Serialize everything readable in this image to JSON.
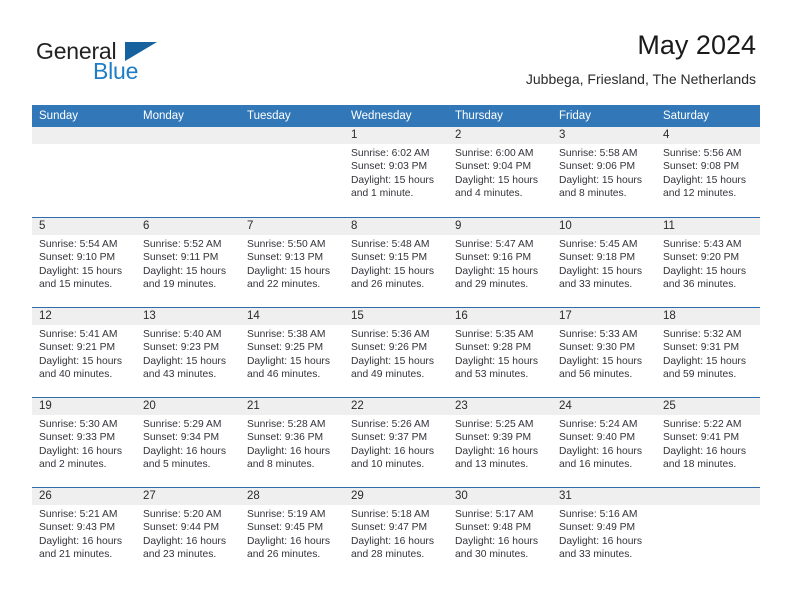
{
  "brand": {
    "word_general": "General",
    "word_blue": "Blue",
    "flag_icon": "blue-triangle-flag"
  },
  "header": {
    "title": "May 2024",
    "subtitle": "Jubbega, Friesland, The Netherlands"
  },
  "colors": {
    "header_blue": "#3278b9",
    "separator_blue": "#2f6ca8",
    "daynum_band": "#efefef",
    "brand_blue": "#1f7dc4",
    "text": "#33333a"
  },
  "weekdays": [
    "Sunday",
    "Monday",
    "Tuesday",
    "Wednesday",
    "Thursday",
    "Friday",
    "Saturday"
  ],
  "weeks": [
    [
      {
        "day": "",
        "lines": []
      },
      {
        "day": "",
        "lines": []
      },
      {
        "day": "",
        "lines": []
      },
      {
        "day": "1",
        "lines": [
          "Sunrise: 6:02 AM",
          "Sunset: 9:03 PM",
          "Daylight: 15 hours",
          "and 1 minute."
        ]
      },
      {
        "day": "2",
        "lines": [
          "Sunrise: 6:00 AM",
          "Sunset: 9:04 PM",
          "Daylight: 15 hours",
          "and 4 minutes."
        ]
      },
      {
        "day": "3",
        "lines": [
          "Sunrise: 5:58 AM",
          "Sunset: 9:06 PM",
          "Daylight: 15 hours",
          "and 8 minutes."
        ]
      },
      {
        "day": "4",
        "lines": [
          "Sunrise: 5:56 AM",
          "Sunset: 9:08 PM",
          "Daylight: 15 hours",
          "and 12 minutes."
        ]
      }
    ],
    [
      {
        "day": "5",
        "lines": [
          "Sunrise: 5:54 AM",
          "Sunset: 9:10 PM",
          "Daylight: 15 hours",
          "and 15 minutes."
        ]
      },
      {
        "day": "6",
        "lines": [
          "Sunrise: 5:52 AM",
          "Sunset: 9:11 PM",
          "Daylight: 15 hours",
          "and 19 minutes."
        ]
      },
      {
        "day": "7",
        "lines": [
          "Sunrise: 5:50 AM",
          "Sunset: 9:13 PM",
          "Daylight: 15 hours",
          "and 22 minutes."
        ]
      },
      {
        "day": "8",
        "lines": [
          "Sunrise: 5:48 AM",
          "Sunset: 9:15 PM",
          "Daylight: 15 hours",
          "and 26 minutes."
        ]
      },
      {
        "day": "9",
        "lines": [
          "Sunrise: 5:47 AM",
          "Sunset: 9:16 PM",
          "Daylight: 15 hours",
          "and 29 minutes."
        ]
      },
      {
        "day": "10",
        "lines": [
          "Sunrise: 5:45 AM",
          "Sunset: 9:18 PM",
          "Daylight: 15 hours",
          "and 33 minutes."
        ]
      },
      {
        "day": "11",
        "lines": [
          "Sunrise: 5:43 AM",
          "Sunset: 9:20 PM",
          "Daylight: 15 hours",
          "and 36 minutes."
        ]
      }
    ],
    [
      {
        "day": "12",
        "lines": [
          "Sunrise: 5:41 AM",
          "Sunset: 9:21 PM",
          "Daylight: 15 hours",
          "and 40 minutes."
        ]
      },
      {
        "day": "13",
        "lines": [
          "Sunrise: 5:40 AM",
          "Sunset: 9:23 PM",
          "Daylight: 15 hours",
          "and 43 minutes."
        ]
      },
      {
        "day": "14",
        "lines": [
          "Sunrise: 5:38 AM",
          "Sunset: 9:25 PM",
          "Daylight: 15 hours",
          "and 46 minutes."
        ]
      },
      {
        "day": "15",
        "lines": [
          "Sunrise: 5:36 AM",
          "Sunset: 9:26 PM",
          "Daylight: 15 hours",
          "and 49 minutes."
        ]
      },
      {
        "day": "16",
        "lines": [
          "Sunrise: 5:35 AM",
          "Sunset: 9:28 PM",
          "Daylight: 15 hours",
          "and 53 minutes."
        ]
      },
      {
        "day": "17",
        "lines": [
          "Sunrise: 5:33 AM",
          "Sunset: 9:30 PM",
          "Daylight: 15 hours",
          "and 56 minutes."
        ]
      },
      {
        "day": "18",
        "lines": [
          "Sunrise: 5:32 AM",
          "Sunset: 9:31 PM",
          "Daylight: 15 hours",
          "and 59 minutes."
        ]
      }
    ],
    [
      {
        "day": "19",
        "lines": [
          "Sunrise: 5:30 AM",
          "Sunset: 9:33 PM",
          "Daylight: 16 hours",
          "and 2 minutes."
        ]
      },
      {
        "day": "20",
        "lines": [
          "Sunrise: 5:29 AM",
          "Sunset: 9:34 PM",
          "Daylight: 16 hours",
          "and 5 minutes."
        ]
      },
      {
        "day": "21",
        "lines": [
          "Sunrise: 5:28 AM",
          "Sunset: 9:36 PM",
          "Daylight: 16 hours",
          "and 8 minutes."
        ]
      },
      {
        "day": "22",
        "lines": [
          "Sunrise: 5:26 AM",
          "Sunset: 9:37 PM",
          "Daylight: 16 hours",
          "and 10 minutes."
        ]
      },
      {
        "day": "23",
        "lines": [
          "Sunrise: 5:25 AM",
          "Sunset: 9:39 PM",
          "Daylight: 16 hours",
          "and 13 minutes."
        ]
      },
      {
        "day": "24",
        "lines": [
          "Sunrise: 5:24 AM",
          "Sunset: 9:40 PM",
          "Daylight: 16 hours",
          "and 16 minutes."
        ]
      },
      {
        "day": "25",
        "lines": [
          "Sunrise: 5:22 AM",
          "Sunset: 9:41 PM",
          "Daylight: 16 hours",
          "and 18 minutes."
        ]
      }
    ],
    [
      {
        "day": "26",
        "lines": [
          "Sunrise: 5:21 AM",
          "Sunset: 9:43 PM",
          "Daylight: 16 hours",
          "and 21 minutes."
        ]
      },
      {
        "day": "27",
        "lines": [
          "Sunrise: 5:20 AM",
          "Sunset: 9:44 PM",
          "Daylight: 16 hours",
          "and 23 minutes."
        ]
      },
      {
        "day": "28",
        "lines": [
          "Sunrise: 5:19 AM",
          "Sunset: 9:45 PM",
          "Daylight: 16 hours",
          "and 26 minutes."
        ]
      },
      {
        "day": "29",
        "lines": [
          "Sunrise: 5:18 AM",
          "Sunset: 9:47 PM",
          "Daylight: 16 hours",
          "and 28 minutes."
        ]
      },
      {
        "day": "30",
        "lines": [
          "Sunrise: 5:17 AM",
          "Sunset: 9:48 PM",
          "Daylight: 16 hours",
          "and 30 minutes."
        ]
      },
      {
        "day": "31",
        "lines": [
          "Sunrise: 5:16 AM",
          "Sunset: 9:49 PM",
          "Daylight: 16 hours",
          "and 33 minutes."
        ]
      },
      {
        "day": "",
        "lines": []
      }
    ]
  ]
}
